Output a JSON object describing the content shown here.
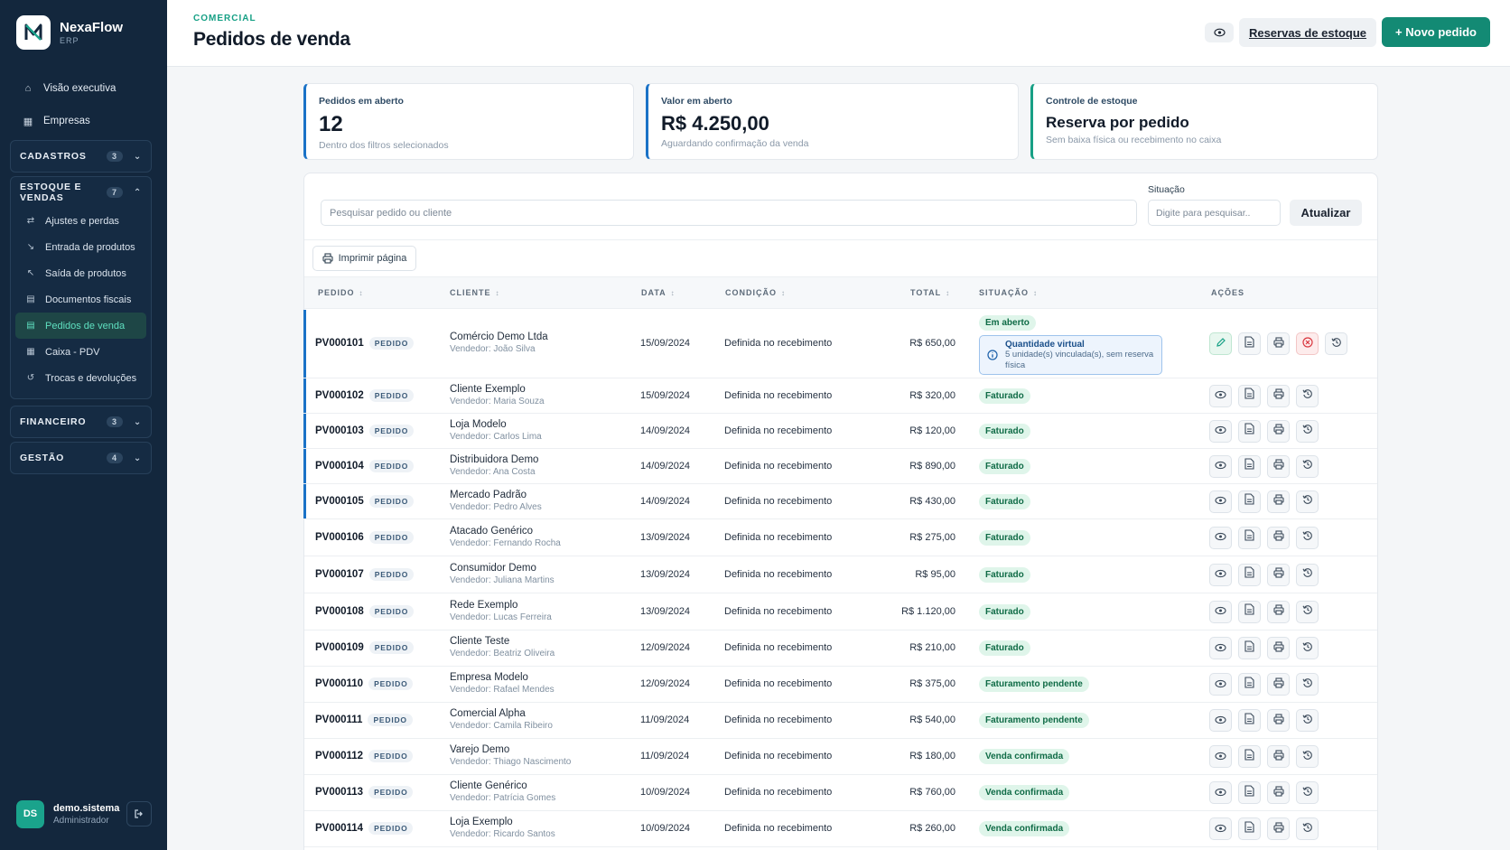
{
  "app": {
    "name": "NexaFlow",
    "subtitle": "ERP"
  },
  "sidebar": {
    "top_items": [
      {
        "label": "Visão executiva",
        "icon": "home-icon"
      },
      {
        "label": "Empresas",
        "icon": "building-icon"
      }
    ],
    "groups": [
      {
        "title": "CADASTROS",
        "count": "3",
        "expanded": false
      },
      {
        "title": "ESTOQUE E VENDAS",
        "count": "7",
        "expanded": true,
        "items": [
          {
            "label": "Ajustes e perdas",
            "icon": "swap-icon"
          },
          {
            "label": "Entrada de produtos",
            "icon": "arrow-in-icon"
          },
          {
            "label": "Saída de produtos",
            "icon": "arrow-out-icon"
          },
          {
            "label": "Documentos fiscais",
            "icon": "document-icon"
          },
          {
            "label": "Pedidos de venda",
            "icon": "list-icon",
            "active": true
          },
          {
            "label": "Caixa - PDV",
            "icon": "register-icon"
          },
          {
            "label": "Trocas e devoluções",
            "icon": "return-icon"
          }
        ]
      },
      {
        "title": "FINANCEIRO",
        "count": "3",
        "expanded": false
      },
      {
        "title": "GESTÃO",
        "count": "4",
        "expanded": false
      }
    ],
    "user": {
      "initials": "DS",
      "name": "demo.sistema",
      "role": "Administrador"
    }
  },
  "header": {
    "breadcrumb": "COMERCIAL",
    "title": "Pedidos de venda",
    "reservations_label": "Reservas de estoque",
    "new_order_label": "+ Novo pedido"
  },
  "kpis": [
    {
      "label": "Pedidos em aberto",
      "value": "12",
      "hint": "Dentro dos filtros selecionados"
    },
    {
      "label": "Valor em aberto",
      "value": "R$ 4.250,00",
      "hint": "Aguardando confirmação da venda"
    },
    {
      "label": "Controle de estoque",
      "value": "Reserva por pedido",
      "hint": "Sem baixa física ou recebimento no caixa"
    }
  ],
  "filters": {
    "search_placeholder": "Pesquisar pedido ou cliente",
    "status_label": "Situação",
    "status_placeholder": "Digite para pesquisar..",
    "update_label": "Atualizar",
    "print_label": "Imprimir página"
  },
  "table": {
    "columns": [
      "PEDIDO",
      "CLIENTE",
      "DATA",
      "CONDIÇÃO",
      "TOTAL",
      "SITUAÇÃO",
      "AÇÕES"
    ],
    "tag_label": "PEDIDO",
    "virtual_qty": {
      "title": "Quantidade virtual",
      "text": "5 unidade(s) vinculada(s), sem reserva física"
    },
    "rows": [
      {
        "id": "PV000101",
        "client": "Comércio Demo Ltda",
        "seller": "Vendedor: João Silva",
        "date": "15/09/2024",
        "condition": "Definida no recebimento",
        "total": "R$ 650,00",
        "status": "Em aberto"
      },
      {
        "id": "PV000102",
        "client": "Cliente Exemplo",
        "seller": "Vendedor: Maria Souza",
        "date": "15/09/2024",
        "condition": "Definida no recebimento",
        "total": "R$ 320,00",
        "status": "Faturado"
      },
      {
        "id": "PV000103",
        "client": "Loja Modelo",
        "seller": "Vendedor: Carlos Lima",
        "date": "14/09/2024",
        "condition": "Definida no recebimento",
        "total": "R$ 120,00",
        "status": "Faturado"
      },
      {
        "id": "PV000104",
        "client": "Distribuidora Demo",
        "seller": "Vendedor: Ana Costa",
        "date": "14/09/2024",
        "condition": "Definida no recebimento",
        "total": "R$ 890,00",
        "status": "Faturado"
      },
      {
        "id": "PV000105",
        "client": "Mercado Padrão",
        "seller": "Vendedor: Pedro Alves",
        "date": "14/09/2024",
        "condition": "Definida no recebimento",
        "total": "R$ 430,00",
        "status": "Faturado"
      },
      {
        "id": "PV000106",
        "client": "Atacado Genérico",
        "seller": "Vendedor: Fernando Rocha",
        "date": "13/09/2024",
        "condition": "Definida no recebimento",
        "total": "R$ 275,00",
        "status": "Faturado"
      },
      {
        "id": "PV000107",
        "client": "Consumidor Demo",
        "seller": "Vendedor: Juliana Martins",
        "date": "13/09/2024",
        "condition": "Definida no recebimento",
        "total": "R$ 95,00",
        "status": "Faturado"
      },
      {
        "id": "PV000108",
        "client": "Rede Exemplo",
        "seller": "Vendedor: Lucas Ferreira",
        "date": "13/09/2024",
        "condition": "Definida no recebimento",
        "total": "R$ 1.120,00",
        "status": "Faturado"
      },
      {
        "id": "PV000109",
        "client": "Cliente Teste",
        "seller": "Vendedor: Beatriz Oliveira",
        "date": "12/09/2024",
        "condition": "Definida no recebimento",
        "total": "R$ 210,00",
        "status": "Faturado"
      },
      {
        "id": "PV000110",
        "client": "Empresa Modelo",
        "seller": "Vendedor: Rafael Mendes",
        "date": "12/09/2024",
        "condition": "Definida no recebimento",
        "total": "R$ 375,00",
        "status": "Faturamento pendente"
      },
      {
        "id": "PV000111",
        "client": "Comercial Alpha",
        "seller": "Vendedor: Camila Ribeiro",
        "date": "11/09/2024",
        "condition": "Definida no recebimento",
        "total": "R$ 540,00",
        "status": "Faturamento pendente"
      },
      {
        "id": "PV000112",
        "client": "Varejo Demo",
        "seller": "Vendedor: Thiago Nascimento",
        "date": "11/09/2024",
        "condition": "Definida no recebimento",
        "total": "R$ 180,00",
        "status": "Venda confirmada"
      },
      {
        "id": "PV000113",
        "client": "Cliente Genérico",
        "seller": "Vendedor: Patrícia Gomes",
        "date": "10/09/2024",
        "condition": "Definida no recebimento",
        "total": "R$ 760,00",
        "status": "Venda confirmada"
      },
      {
        "id": "PV000114",
        "client": "Loja Exemplo",
        "seller": "Vendedor: Ricardo Santos",
        "date": "10/09/2024",
        "condition": "Definida no recebimento",
        "total": "R$ 260,00",
        "status": "Venda confirmada"
      }
    ]
  },
  "colors": {
    "accent": "#138a74",
    "sidebar_bg": "#13273d",
    "highlight_blue": "#1a72c7",
    "status_green": "#0f6b46"
  }
}
